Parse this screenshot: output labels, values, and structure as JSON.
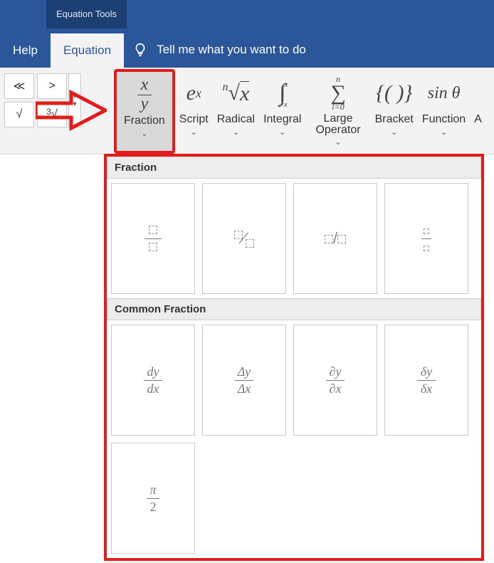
{
  "title_tab": "Equation Tools",
  "tabs": {
    "help": "Help",
    "equation": "Equation"
  },
  "tellme": "Tell me what you want to do",
  "ribbon": {
    "fraction": "Fraction",
    "script": "Script",
    "radical": "Radical",
    "integral": "Integral",
    "large_op": "Large\nOperator",
    "bracket": "Bracket",
    "function": "Function",
    "accent_partial": "A"
  },
  "dropdown": {
    "section1": "Fraction",
    "section2": "Common Fraction",
    "items1": [
      "stacked",
      "skewed",
      "linear",
      "small"
    ],
    "items2": [
      "dy/dx",
      "Δy/Δx",
      "∂y/∂x",
      "δy/δx",
      "π/2"
    ]
  }
}
